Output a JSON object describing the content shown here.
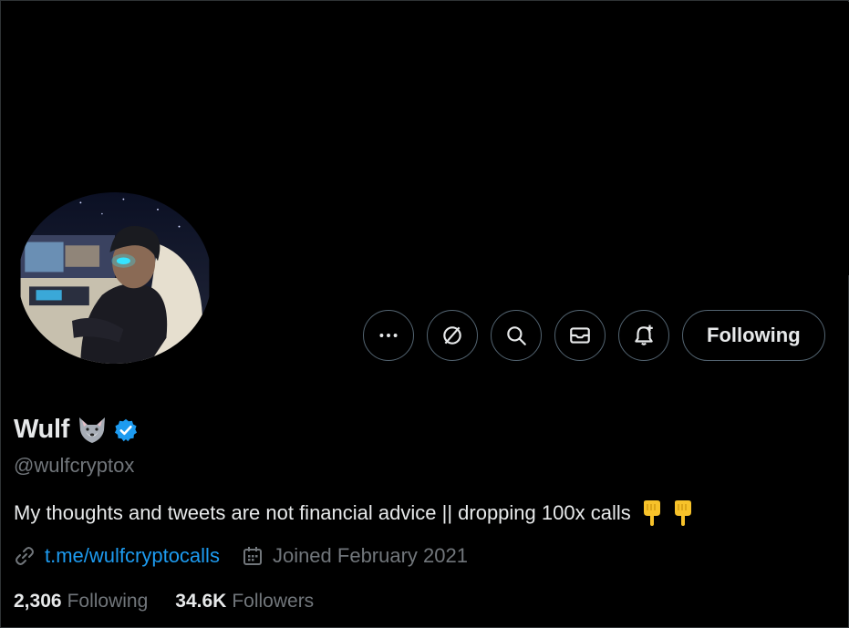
{
  "profile": {
    "display_name": "Wulf",
    "name_emoji": "wolf-face-emoji",
    "verified": true,
    "handle": "@wulfcryptox",
    "bio_text": "My thoughts and tweets are not financial advice || dropping 100x calls",
    "bio_emojis": [
      "pointing-down-emoji",
      "pointing-down-emoji"
    ],
    "link_text": "t.me/wulfcryptocalls",
    "joined_text": "Joined February 2021"
  },
  "actions": {
    "more_icon": "more-horizontal-icon",
    "grok_icon": "grok-icon",
    "search_icon": "search-icon",
    "message_icon": "message-icon",
    "notify_icon": "notification-bell-icon",
    "following_label": "Following"
  },
  "stats": {
    "following_count": "2,306",
    "following_label": "Following",
    "followers_count": "34.6K",
    "followers_label": "Followers"
  },
  "colors": {
    "background": "#000000",
    "text_primary": "#e7e9ea",
    "text_secondary": "#71767b",
    "accent": "#1d9bf0",
    "border": "#536471"
  }
}
